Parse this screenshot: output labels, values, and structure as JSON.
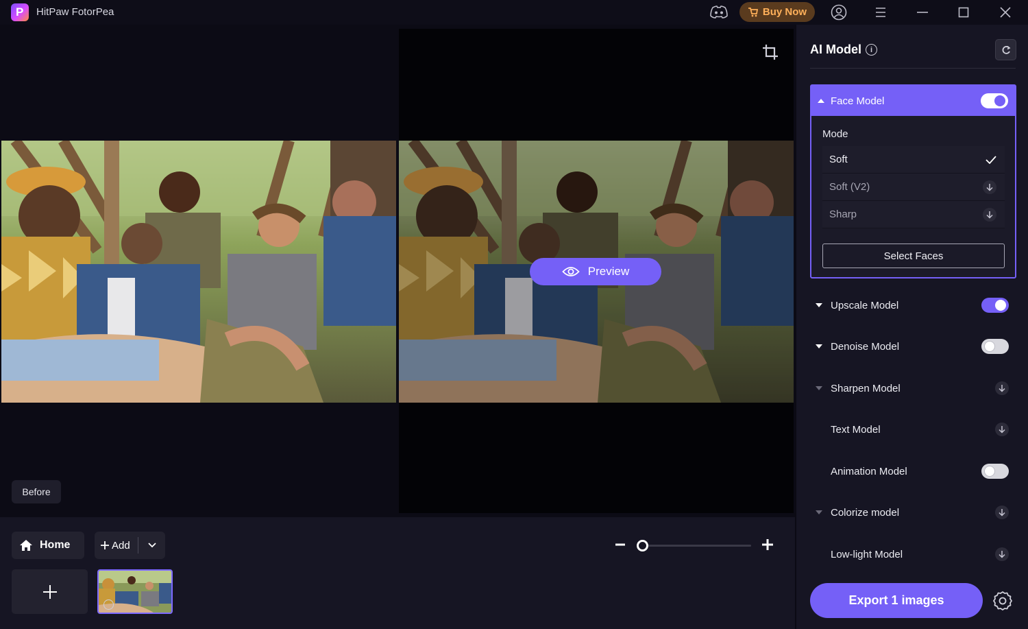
{
  "app": {
    "title": "HitPaw FotorPea",
    "logo_letter": "P"
  },
  "titlebar": {
    "buy_now": "Buy Now"
  },
  "canvas": {
    "preview_label": "Preview",
    "before_label": "Before"
  },
  "bottombar": {
    "home_label": "Home",
    "add_label": "Add"
  },
  "panel": {
    "title": "AI Model",
    "info_glyph": "i",
    "face_model": {
      "name": "Face Model",
      "enabled": true,
      "mode_label": "Mode",
      "modes": [
        {
          "label": "Soft",
          "state": "selected"
        },
        {
          "label": "Soft (V2)",
          "state": "download"
        },
        {
          "label": "Sharp",
          "state": "download"
        }
      ],
      "select_faces": "Select Faces"
    },
    "models": [
      {
        "name": "Upscale Model",
        "control": "toggle",
        "enabled": true
      },
      {
        "name": "Denoise Model",
        "control": "toggle",
        "enabled": false
      },
      {
        "name": "Sharpen Model",
        "control": "download"
      },
      {
        "name": "Text Model",
        "control": "download"
      },
      {
        "name": "Animation Model",
        "control": "toggle",
        "enabled": false
      },
      {
        "name": "Colorize model",
        "control": "download"
      },
      {
        "name": "Low-light Model",
        "control": "download"
      }
    ],
    "export_label": "Export 1 images"
  },
  "colors": {
    "accent": "#7560f7",
    "buy_now_text": "#ffb05a",
    "panel_bg": "#161523",
    "canvas_bg": "#0c0b15"
  }
}
